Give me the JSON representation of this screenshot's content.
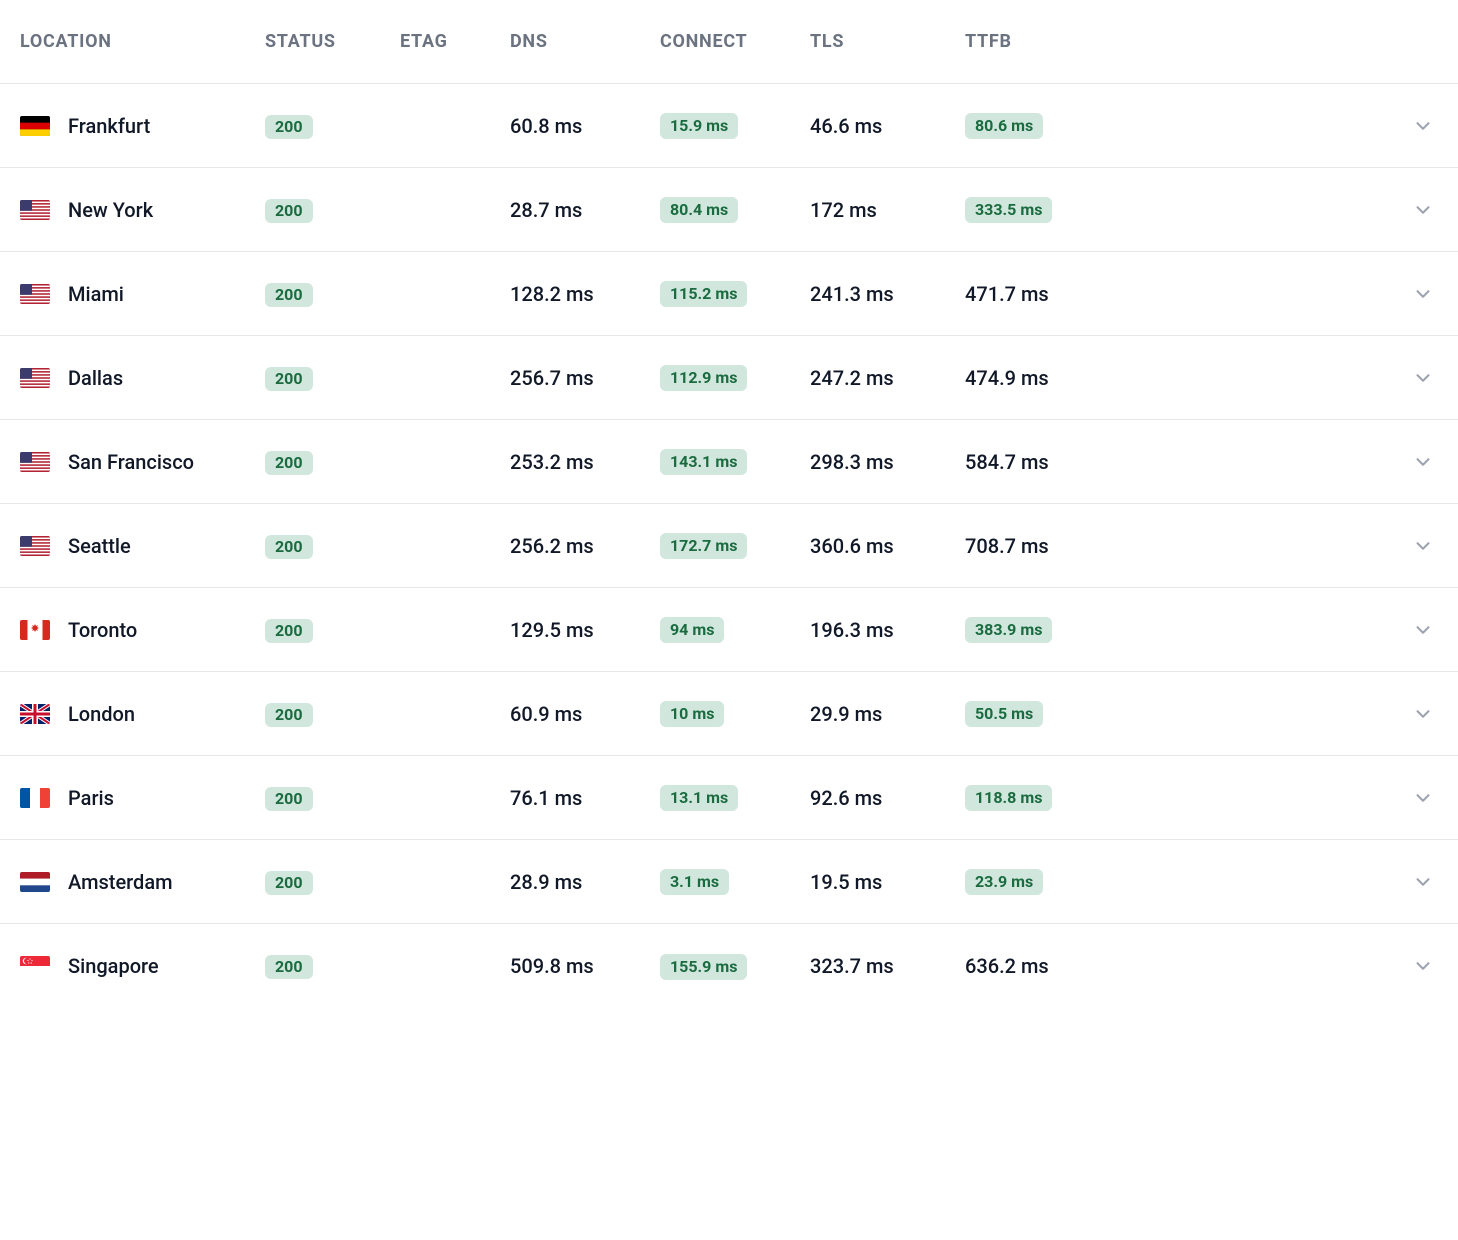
{
  "columns": {
    "location": "Location",
    "status": "Status",
    "etag": "ETag",
    "dns": "DNS",
    "connect": "Connect",
    "tls": "TLS",
    "ttfb": "TTFB"
  },
  "rows": [
    {
      "flag": "de",
      "location": "Frankfurt",
      "status": "200",
      "etag": "",
      "dns": "60.8 ms",
      "connect": "15.9 ms",
      "connect_badge": true,
      "tls": "46.6 ms",
      "ttfb": "80.6 ms",
      "ttfb_badge": true
    },
    {
      "flag": "us",
      "location": "New York",
      "status": "200",
      "etag": "",
      "dns": "28.7 ms",
      "connect": "80.4 ms",
      "connect_badge": true,
      "tls": "172 ms",
      "ttfb": "333.5 ms",
      "ttfb_badge": true
    },
    {
      "flag": "us",
      "location": "Miami",
      "status": "200",
      "etag": "",
      "dns": "128.2 ms",
      "connect": "115.2 ms",
      "connect_badge": true,
      "tls": "241.3 ms",
      "ttfb": "471.7 ms",
      "ttfb_badge": false
    },
    {
      "flag": "us",
      "location": "Dallas",
      "status": "200",
      "etag": "",
      "dns": "256.7 ms",
      "connect": "112.9 ms",
      "connect_badge": true,
      "tls": "247.2 ms",
      "ttfb": "474.9 ms",
      "ttfb_badge": false
    },
    {
      "flag": "us",
      "location": "San Francisco",
      "status": "200",
      "etag": "",
      "dns": "253.2 ms",
      "connect": "143.1 ms",
      "connect_badge": true,
      "tls": "298.3 ms",
      "ttfb": "584.7 ms",
      "ttfb_badge": false
    },
    {
      "flag": "us",
      "location": "Seattle",
      "status": "200",
      "etag": "",
      "dns": "256.2 ms",
      "connect": "172.7 ms",
      "connect_badge": true,
      "tls": "360.6 ms",
      "ttfb": "708.7 ms",
      "ttfb_badge": false
    },
    {
      "flag": "ca",
      "location": "Toronto",
      "status": "200",
      "etag": "",
      "dns": "129.5 ms",
      "connect": "94 ms",
      "connect_badge": true,
      "tls": "196.3 ms",
      "ttfb": "383.9 ms",
      "ttfb_badge": true
    },
    {
      "flag": "gb",
      "location": "London",
      "status": "200",
      "etag": "",
      "dns": "60.9 ms",
      "connect": "10 ms",
      "connect_badge": true,
      "tls": "29.9 ms",
      "ttfb": "50.5 ms",
      "ttfb_badge": true
    },
    {
      "flag": "fr",
      "location": "Paris",
      "status": "200",
      "etag": "",
      "dns": "76.1 ms",
      "connect": "13.1 ms",
      "connect_badge": true,
      "tls": "92.6 ms",
      "ttfb": "118.8 ms",
      "ttfb_badge": true
    },
    {
      "flag": "nl",
      "location": "Amsterdam",
      "status": "200",
      "etag": "",
      "dns": "28.9 ms",
      "connect": "3.1 ms",
      "connect_badge": true,
      "tls": "19.5 ms",
      "ttfb": "23.9 ms",
      "ttfb_badge": true
    },
    {
      "flag": "sg",
      "location": "Singapore",
      "status": "200",
      "etag": "",
      "dns": "509.8 ms",
      "connect": "155.9 ms",
      "connect_badge": true,
      "tls": "323.7 ms",
      "ttfb": "636.2 ms",
      "ttfb_badge": false
    }
  ]
}
